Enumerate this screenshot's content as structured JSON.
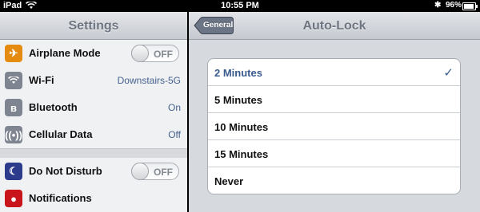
{
  "statusbar": {
    "device": "iPad",
    "time": "10:55 PM",
    "battery_percent": "96%",
    "battery_level": 0.96,
    "icons": [
      "wifi-icon",
      "bluetooth-icon",
      "battery-icon"
    ]
  },
  "master": {
    "title": "Settings",
    "rows": [
      {
        "label": "Airplane Mode",
        "toggle": "OFF",
        "icon": "airplane-icon",
        "color": "#e58b10"
      },
      {
        "label": "Wi-Fi",
        "value": "Downstairs-5G",
        "icon": "wifi-icon",
        "color": "#7f8590"
      },
      {
        "label": "Bluetooth",
        "value": "On",
        "icon": "bluetooth-icon",
        "color": "#7f8590"
      },
      {
        "label": "Cellular Data",
        "value": "Off",
        "icon": "cellular-icon",
        "color": "#7f8590"
      },
      {
        "label": "Do Not Disturb",
        "toggle": "OFF",
        "icon": "moon-icon",
        "color": "#2c3b8c"
      },
      {
        "label": "Notifications",
        "icon": "notifications-icon",
        "color": "#c8141a"
      }
    ]
  },
  "detail": {
    "back_label": "General",
    "title": "Auto-Lock",
    "options": [
      {
        "label": "2 Minutes",
        "selected": true
      },
      {
        "label": "5 Minutes",
        "selected": false
      },
      {
        "label": "10 Minutes",
        "selected": false
      },
      {
        "label": "15 Minutes",
        "selected": false
      },
      {
        "label": "Never",
        "selected": false
      }
    ],
    "check_glyph": "✓"
  }
}
